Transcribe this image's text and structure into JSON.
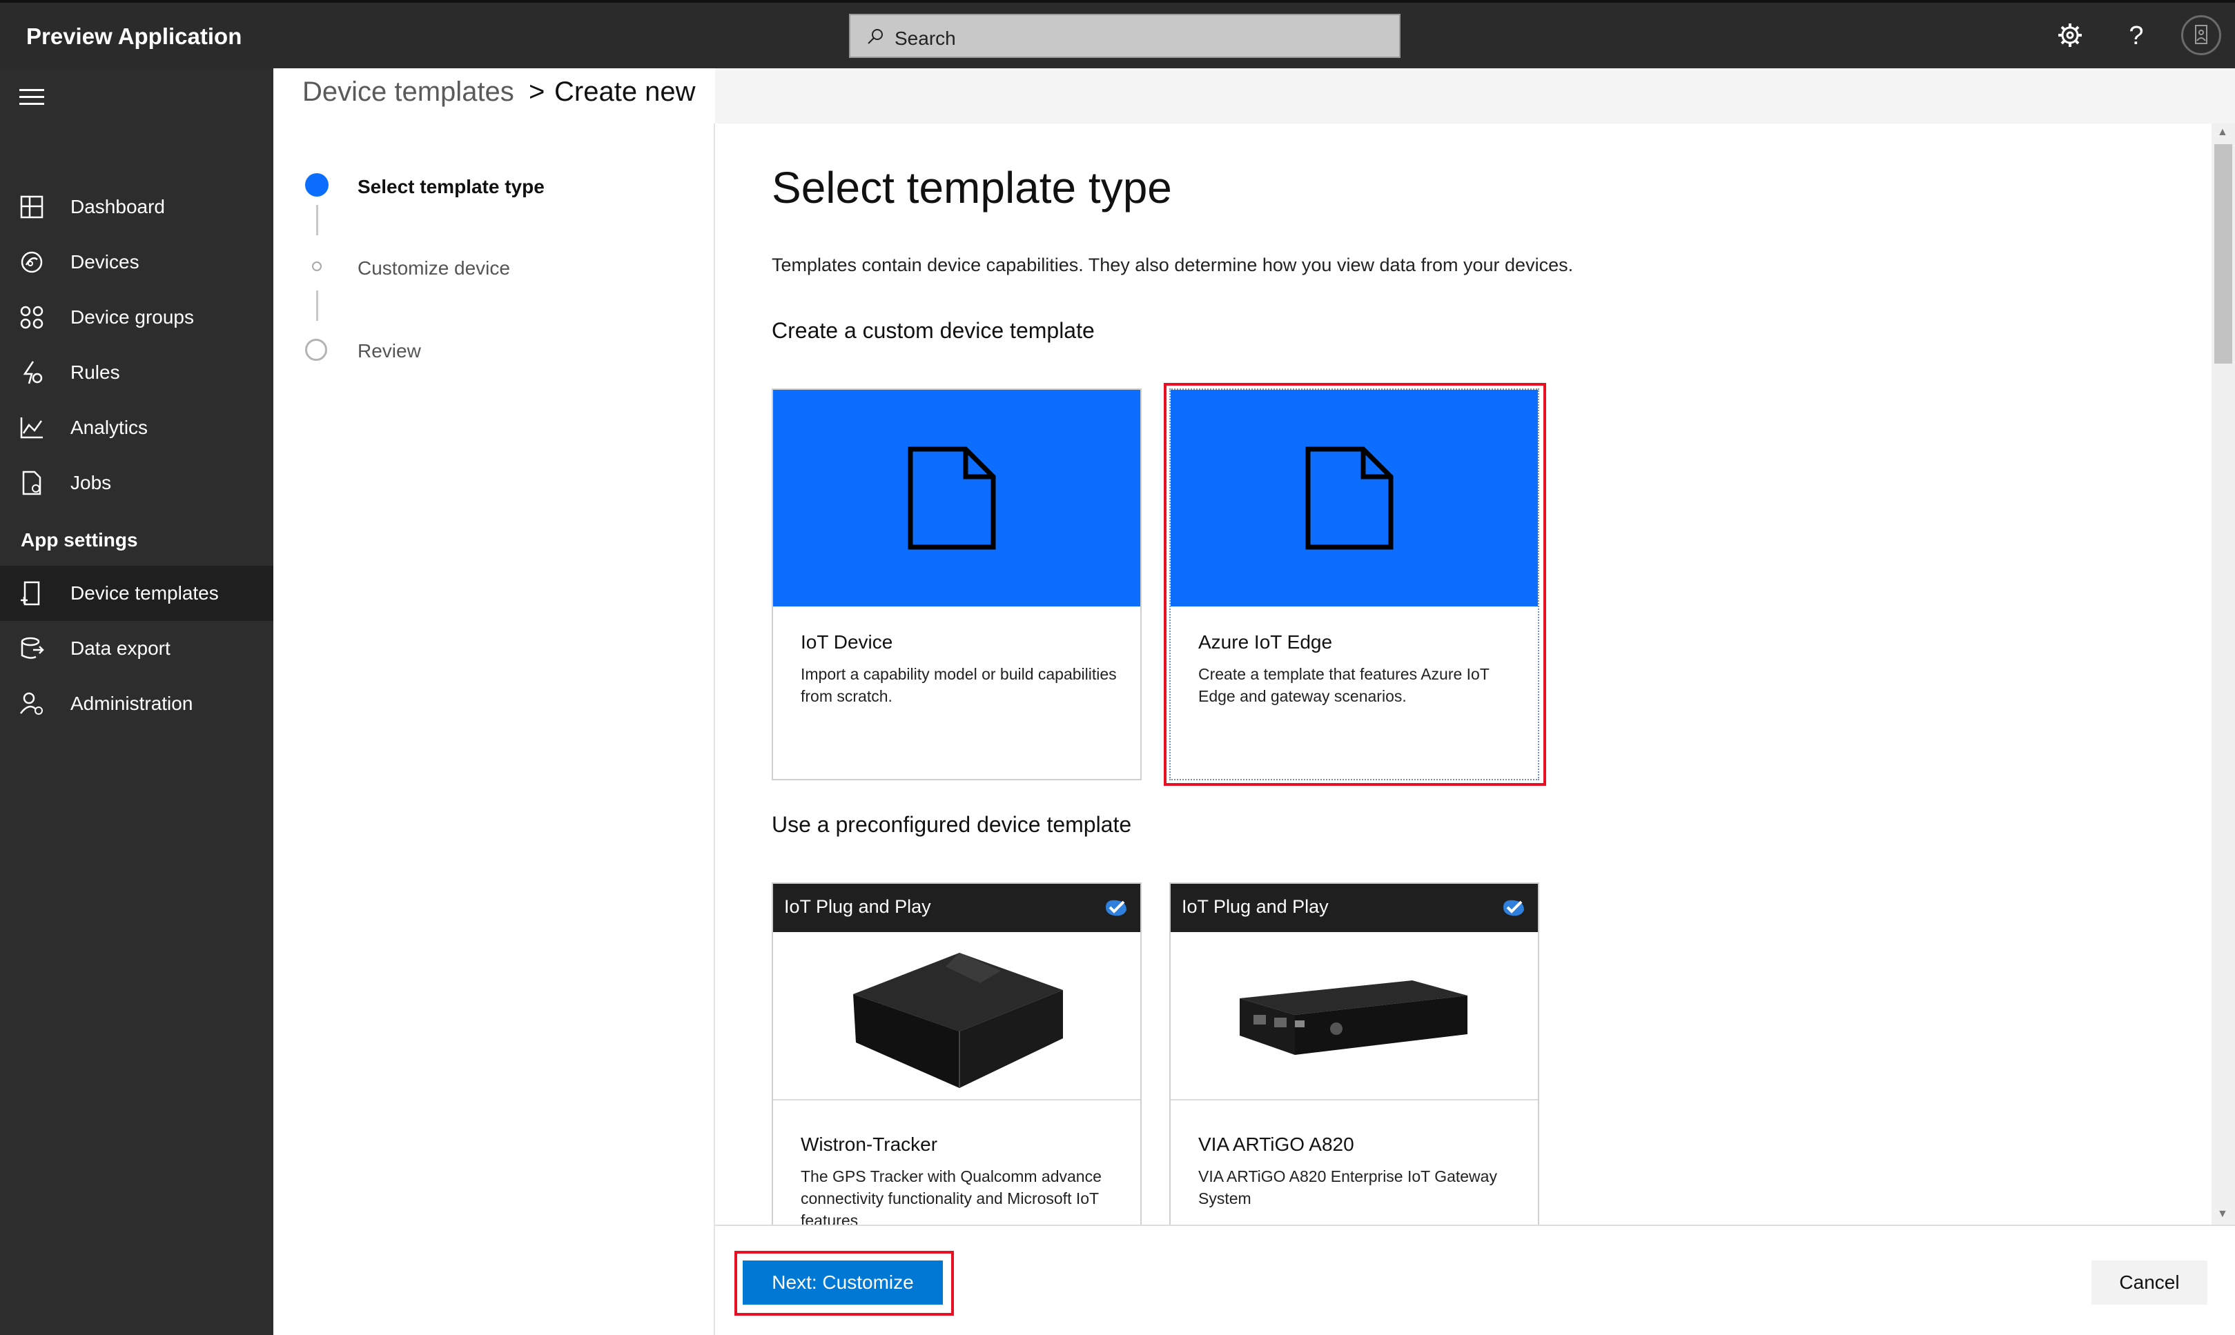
{
  "app": {
    "title": "Preview Application"
  },
  "search": {
    "placeholder": "Search"
  },
  "sidebar": {
    "items": [
      {
        "label": "Dashboard",
        "icon": "dashboard-icon"
      },
      {
        "label": "Devices",
        "icon": "devices-icon"
      },
      {
        "label": "Device groups",
        "icon": "device-groups-icon"
      },
      {
        "label": "Rules",
        "icon": "rules-icon"
      },
      {
        "label": "Analytics",
        "icon": "analytics-icon"
      },
      {
        "label": "Jobs",
        "icon": "jobs-icon"
      }
    ],
    "section": "App settings",
    "settings_items": [
      {
        "label": "Device templates",
        "icon": "device-templates-icon",
        "active": true
      },
      {
        "label": "Data export",
        "icon": "data-export-icon"
      },
      {
        "label": "Administration",
        "icon": "administration-icon"
      }
    ]
  },
  "breadcrumb": {
    "parent": "Device templates",
    "separator": ">",
    "current": "Create new"
  },
  "stepper": {
    "steps": [
      {
        "label": "Select template type",
        "state": "current"
      },
      {
        "label": "Customize device",
        "state": "upcoming"
      },
      {
        "label": "Review",
        "state": "upcoming"
      }
    ]
  },
  "main": {
    "title": "Select template type",
    "description": "Templates contain device capabilities. They also determine how you view data from your devices.",
    "custom_heading": "Create a custom device template",
    "custom_cards": [
      {
        "title": "IoT Device",
        "description": "Import a capability model or build capabilities from scratch."
      },
      {
        "title": "Azure IoT Edge",
        "description": "Create a template that features Azure IoT Edge and gateway scenarios.",
        "selected": true
      }
    ],
    "preconfigured_heading": "Use a preconfigured device template",
    "preconfigured_cards": [
      {
        "badge": "IoT Plug and Play",
        "title": "Wistron-Tracker",
        "description": "The GPS Tracker with Qualcomm advance connectivity functionality and Microsoft IoT features"
      },
      {
        "badge": "IoT Plug and Play",
        "title": "VIA ARTiGO A820",
        "description": "VIA ARTiGO A820 Enterprise IoT Gateway System"
      }
    ]
  },
  "footer": {
    "next_label": "Next: Customize",
    "cancel_label": "Cancel"
  },
  "colors": {
    "accent": "#0d6efd",
    "primary_button": "#0078d4",
    "highlight": "#e81123",
    "topbar": "#2b2b2b",
    "sidebar": "#2d2d2d"
  }
}
